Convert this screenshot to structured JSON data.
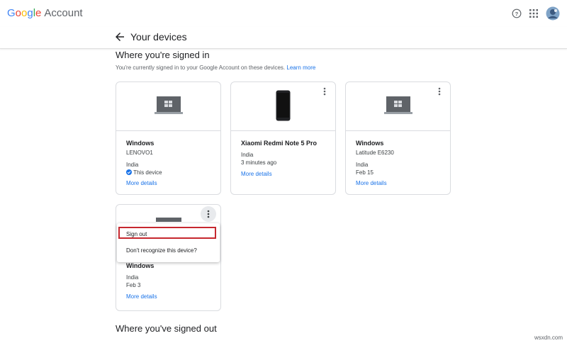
{
  "header": {
    "logo_letters": [
      "G",
      "o",
      "o",
      "g",
      "l",
      "e"
    ],
    "logo_suffix": "Account",
    "help_icon": "help-circle-icon",
    "apps_icon": "apps-grid-icon",
    "avatar_icon": "avatar"
  },
  "subheader": {
    "title": "Your devices"
  },
  "signed_in": {
    "title": "Where you're signed in",
    "description": "You're currently signed in to your Google Account on these devices.",
    "learn_more": "Learn more"
  },
  "devices": [
    {
      "name": "Windows",
      "model": "LENOVO1",
      "location": "India",
      "status": "This device",
      "more": "More details",
      "kind": "laptop"
    },
    {
      "name": "Xiaomi Redmi Note 5 Pro",
      "model": "India",
      "location": "3 minutes ago",
      "more": "More details",
      "kind": "phone"
    },
    {
      "name": "Windows",
      "model": "Latitude E6230",
      "location": "India",
      "status": "Feb 15",
      "more": "More details",
      "kind": "laptop"
    },
    {
      "name": "Windows",
      "model": "India",
      "location": "Feb 3",
      "more": "More details",
      "kind": "laptop"
    }
  ],
  "menu": {
    "sign_out": "Sign out",
    "dont_recognize": "Don't recognize this device?"
  },
  "signed_out": {
    "title": "Where you've signed out"
  },
  "watermark": "wsxdn.com"
}
